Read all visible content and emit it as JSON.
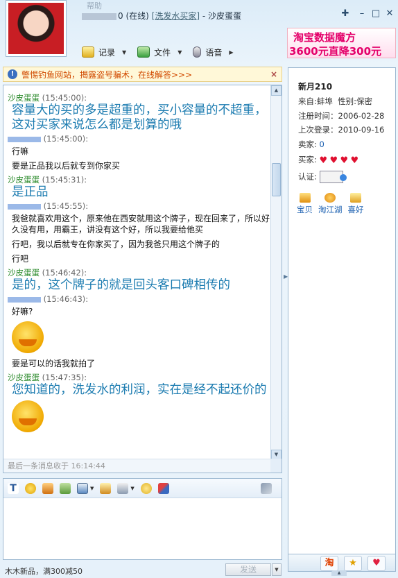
{
  "window": {
    "menu_faint": "帮助",
    "title_suffix": "0 (在线)",
    "title_link": "[洗发水买家]",
    "title_sep": "-",
    "title_contact": "沙皮蛋蛋"
  },
  "toolbar": {
    "record_label": "记录",
    "file_label": "文件",
    "voice_label": "语音"
  },
  "ad": {
    "line1": "淘宝数据魔方",
    "line2": "3600元直降300元"
  },
  "warning": {
    "text": "警惕钓鱼网站，揭露盗号骗术，在线解答>>>",
    "close": "×"
  },
  "messages": [
    {
      "sender": "沙皮蛋蛋",
      "time": "(15:45:00):",
      "style": "big",
      "lines": [
        "容量大的买的多是超重的，买小容量的不超重，这对买家来说怎么都是划算的哦"
      ]
    },
    {
      "sender": "",
      "time": "(15:45:00):",
      "style": "small",
      "lines": [
        "行嘛",
        "要是正品我以后就专到你家买"
      ]
    },
    {
      "sender": "沙皮蛋蛋",
      "time": "(15:45:31):",
      "style": "big",
      "lines": [
        "是正品"
      ]
    },
    {
      "sender": "",
      "time": "(15:45:55):",
      "style": "small",
      "lines": [
        "我爸就喜欢用这个，原来他在西安就用这个牌子，现在回来了，所以好久没有用，用霸王，讲没有这个好，所以我要给他买",
        "行吧，我以后就专在你家买了，因为我爸只用这个牌子的",
        "行吧"
      ]
    },
    {
      "sender": "沙皮蛋蛋",
      "time": "(15:46:42):",
      "style": "big",
      "lines": [
        "是的，这个牌子的就是回头客口碑相传的"
      ]
    },
    {
      "sender": "",
      "time": "(15:46:43):",
      "style": "small",
      "lines": [
        "好嘛?"
      ],
      "emoji": true,
      "after": "要是可以的话我就拍了"
    },
    {
      "sender": "沙皮蛋蛋",
      "time": "(15:47:35):",
      "style": "big",
      "lines": [
        "您知道的，洗发水的利润，实在是经不起还价的"
      ]
    }
  ],
  "chat_footer": {
    "last_message": "最后一条消息收于 16:14:44"
  },
  "bottom": {
    "promo": "木木新品，满300减50",
    "send_label": "发送"
  },
  "profile": {
    "name": "新月210",
    "from": "来自:蚌埠",
    "gender": "性别:保密",
    "reg_label": "注册时间：",
    "reg_date": "2006-02-28",
    "last_label": "上次登录：",
    "last_date": "2010-09-16",
    "seller_label": "卖家:",
    "seller_value": "0",
    "buyer_label": "买家:",
    "cert_label": "认证:",
    "icons": [
      "宝贝",
      "淘江湖",
      "喜好"
    ]
  },
  "side_tabs": [
    "淘",
    "★",
    "♥"
  ],
  "colors": {
    "seller_name": "#2a8a2a",
    "seller_text": "#1b7bb0",
    "buyer_name": "#3a5fc8",
    "warning_text": "#d14a00",
    "ad_text": "#e4006a"
  }
}
